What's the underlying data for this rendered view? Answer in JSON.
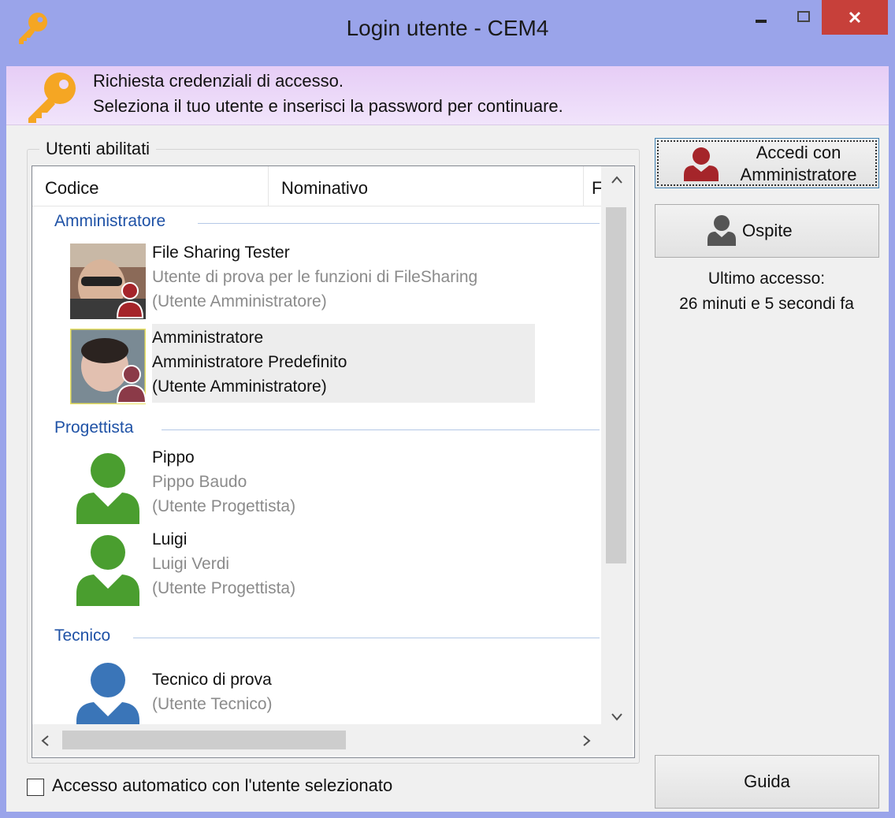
{
  "window": {
    "title": "Login utente - CEM4"
  },
  "banner": {
    "line1": "Richiesta credenziali di accesso.",
    "line2": "Seleziona il tuo utente e inserisci la password per continuare."
  },
  "users_group": {
    "label": "Utenti abilitati"
  },
  "columns": [
    "Codice",
    "Nominativo",
    "F"
  ],
  "groups": [
    {
      "name": "Amministratore"
    },
    {
      "name": "Progettista"
    },
    {
      "name": "Tecnico"
    }
  ],
  "users": [
    {
      "line1": "File Sharing Tester",
      "line2": "Utente di prova per le funzioni di FileSharing",
      "line3": "(Utente Amministratore)",
      "selected": false
    },
    {
      "line1": "Amministratore",
      "line2": "Amministratore Predefinito",
      "line3": "(Utente Amministratore)",
      "selected": true
    },
    {
      "line1": "Pippo",
      "line2": "Pippo Baudo",
      "line3": "(Utente Progettista)",
      "selected": false
    },
    {
      "line1": "Luigi",
      "line2": "Luigi Verdi",
      "line3": "(Utente Progettista)",
      "selected": false
    },
    {
      "line1": "Tecnico di prova",
      "line2": "(Utente Tecnico)",
      "selected": false
    }
  ],
  "buttons": {
    "login_line1": "Accedi con",
    "login_line2": "Amministratore",
    "guest": "Ospite",
    "help": "Guida"
  },
  "last_access": {
    "label": "Ultimo accesso:",
    "value": "26 minuti e 5 secondi fa"
  },
  "auto_login": {
    "label": "Accesso automatico con l'utente selezionato",
    "checked": false
  },
  "colors": {
    "admin_icon": "#a5252a",
    "designer_icon": "#4a9e2f",
    "tech_icon": "#3a75b8",
    "guest_icon": "#555555",
    "group_header": "#1f52a6",
    "close_button": "#c7403a"
  }
}
